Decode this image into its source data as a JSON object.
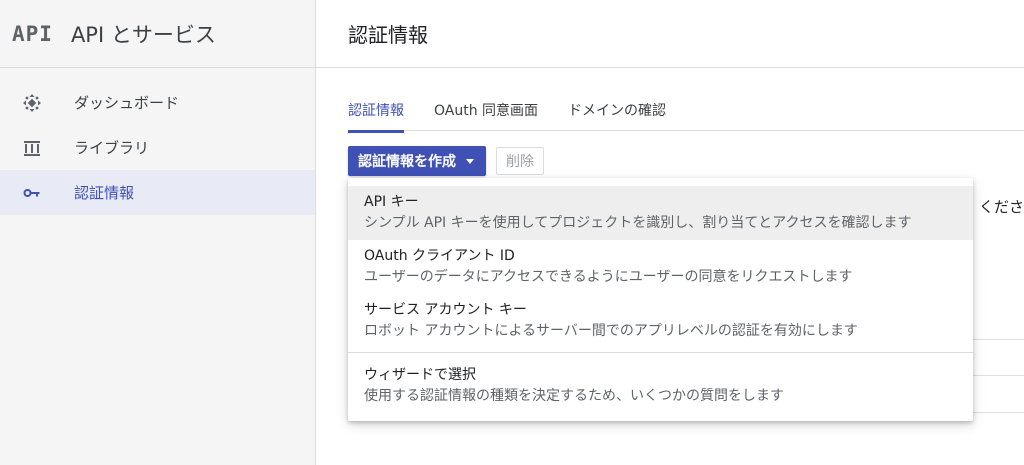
{
  "sidebar": {
    "logo": "API",
    "title": "API とサービス",
    "items": [
      {
        "label": "ダッシュボード",
        "icon": "dashboard-icon"
      },
      {
        "label": "ライブラリ",
        "icon": "library-icon"
      },
      {
        "label": "認証情報",
        "icon": "key-icon",
        "active": true
      }
    ]
  },
  "main": {
    "title": "認証情報",
    "tabs": [
      {
        "label": "認証情報",
        "active": true
      },
      {
        "label": "OAuth 同意画面"
      },
      {
        "label": "ドメインの確認"
      }
    ],
    "toolbar": {
      "create_label": "認証情報を作成",
      "delete_label": "削除"
    },
    "background_text": "ください"
  },
  "menu": {
    "items": [
      {
        "title": "API キー",
        "desc": "シンプル API キーを使用してプロジェクトを識別し、割り当てとアクセスを確認します"
      },
      {
        "title": "OAuth クライアント ID",
        "desc": "ユーザーのデータにアクセスできるようにユーザーの同意をリクエストします"
      },
      {
        "title": "サービス アカウント キー",
        "desc": "ロボット アカウントによるサーバー間でのアプリレベルの認証を有効にします"
      },
      {
        "title": "ウィザードで選択",
        "desc": "使用する認証情報の種類を決定するため、いくつかの質問をします"
      }
    ]
  },
  "colors": {
    "accent": "#3f51b5",
    "sidebar_bg": "#f5f5f5",
    "active_bg": "#e8eaf6"
  }
}
